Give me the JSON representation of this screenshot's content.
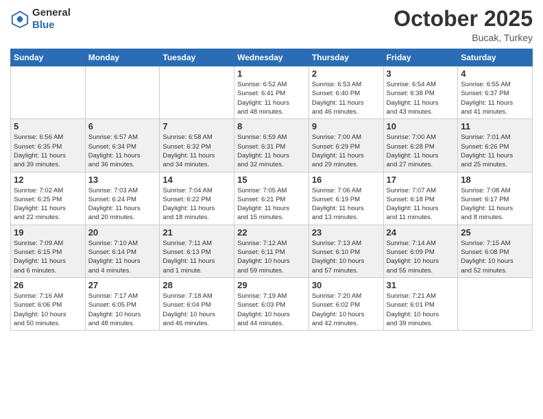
{
  "header": {
    "logo_line1": "General",
    "logo_line2": "Blue",
    "month": "October 2025",
    "location": "Bucak, Turkey"
  },
  "weekdays": [
    "Sunday",
    "Monday",
    "Tuesday",
    "Wednesday",
    "Thursday",
    "Friday",
    "Saturday"
  ],
  "weeks": [
    [
      {
        "day": "",
        "info": ""
      },
      {
        "day": "",
        "info": ""
      },
      {
        "day": "",
        "info": ""
      },
      {
        "day": "1",
        "info": "Sunrise: 6:52 AM\nSunset: 6:41 PM\nDaylight: 11 hours\nand 48 minutes."
      },
      {
        "day": "2",
        "info": "Sunrise: 6:53 AM\nSunset: 6:40 PM\nDaylight: 11 hours\nand 46 minutes."
      },
      {
        "day": "3",
        "info": "Sunrise: 6:54 AM\nSunset: 6:38 PM\nDaylight: 11 hours\nand 43 minutes."
      },
      {
        "day": "4",
        "info": "Sunrise: 6:55 AM\nSunset: 6:37 PM\nDaylight: 11 hours\nand 41 minutes."
      }
    ],
    [
      {
        "day": "5",
        "info": "Sunrise: 6:56 AM\nSunset: 6:35 PM\nDaylight: 11 hours\nand 39 minutes."
      },
      {
        "day": "6",
        "info": "Sunrise: 6:57 AM\nSunset: 6:34 PM\nDaylight: 11 hours\nand 36 minutes."
      },
      {
        "day": "7",
        "info": "Sunrise: 6:58 AM\nSunset: 6:32 PM\nDaylight: 11 hours\nand 34 minutes."
      },
      {
        "day": "8",
        "info": "Sunrise: 6:59 AM\nSunset: 6:31 PM\nDaylight: 11 hours\nand 32 minutes."
      },
      {
        "day": "9",
        "info": "Sunrise: 7:00 AM\nSunset: 6:29 PM\nDaylight: 11 hours\nand 29 minutes."
      },
      {
        "day": "10",
        "info": "Sunrise: 7:00 AM\nSunset: 6:28 PM\nDaylight: 11 hours\nand 27 minutes."
      },
      {
        "day": "11",
        "info": "Sunrise: 7:01 AM\nSunset: 6:26 PM\nDaylight: 11 hours\nand 25 minutes."
      }
    ],
    [
      {
        "day": "12",
        "info": "Sunrise: 7:02 AM\nSunset: 6:25 PM\nDaylight: 11 hours\nand 22 minutes."
      },
      {
        "day": "13",
        "info": "Sunrise: 7:03 AM\nSunset: 6:24 PM\nDaylight: 11 hours\nand 20 minutes."
      },
      {
        "day": "14",
        "info": "Sunrise: 7:04 AM\nSunset: 6:22 PM\nDaylight: 11 hours\nand 18 minutes."
      },
      {
        "day": "15",
        "info": "Sunrise: 7:05 AM\nSunset: 6:21 PM\nDaylight: 11 hours\nand 15 minutes."
      },
      {
        "day": "16",
        "info": "Sunrise: 7:06 AM\nSunset: 6:19 PM\nDaylight: 11 hours\nand 13 minutes."
      },
      {
        "day": "17",
        "info": "Sunrise: 7:07 AM\nSunset: 6:18 PM\nDaylight: 11 hours\nand 11 minutes."
      },
      {
        "day": "18",
        "info": "Sunrise: 7:08 AM\nSunset: 6:17 PM\nDaylight: 11 hours\nand 8 minutes."
      }
    ],
    [
      {
        "day": "19",
        "info": "Sunrise: 7:09 AM\nSunset: 6:15 PM\nDaylight: 11 hours\nand 6 minutes."
      },
      {
        "day": "20",
        "info": "Sunrise: 7:10 AM\nSunset: 6:14 PM\nDaylight: 11 hours\nand 4 minutes."
      },
      {
        "day": "21",
        "info": "Sunrise: 7:11 AM\nSunset: 6:13 PM\nDaylight: 11 hours\nand 1 minute."
      },
      {
        "day": "22",
        "info": "Sunrise: 7:12 AM\nSunset: 6:11 PM\nDaylight: 10 hours\nand 59 minutes."
      },
      {
        "day": "23",
        "info": "Sunrise: 7:13 AM\nSunset: 6:10 PM\nDaylight: 10 hours\nand 57 minutes."
      },
      {
        "day": "24",
        "info": "Sunrise: 7:14 AM\nSunset: 6:09 PM\nDaylight: 10 hours\nand 55 minutes."
      },
      {
        "day": "25",
        "info": "Sunrise: 7:15 AM\nSunset: 6:08 PM\nDaylight: 10 hours\nand 52 minutes."
      }
    ],
    [
      {
        "day": "26",
        "info": "Sunrise: 7:16 AM\nSunset: 6:06 PM\nDaylight: 10 hours\nand 50 minutes."
      },
      {
        "day": "27",
        "info": "Sunrise: 7:17 AM\nSunset: 6:05 PM\nDaylight: 10 hours\nand 48 minutes."
      },
      {
        "day": "28",
        "info": "Sunrise: 7:18 AM\nSunset: 6:04 PM\nDaylight: 10 hours\nand 46 minutes."
      },
      {
        "day": "29",
        "info": "Sunrise: 7:19 AM\nSunset: 6:03 PM\nDaylight: 10 hours\nand 44 minutes."
      },
      {
        "day": "30",
        "info": "Sunrise: 7:20 AM\nSunset: 6:02 PM\nDaylight: 10 hours\nand 42 minutes."
      },
      {
        "day": "31",
        "info": "Sunrise: 7:21 AM\nSunset: 6:01 PM\nDaylight: 10 hours\nand 39 minutes."
      },
      {
        "day": "",
        "info": ""
      }
    ]
  ]
}
